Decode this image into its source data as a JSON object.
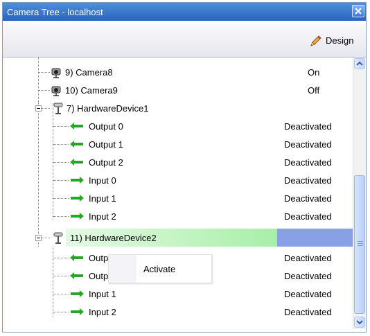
{
  "window": {
    "title": "Camera Tree - localhost"
  },
  "toolbar": {
    "design_label": "Design"
  },
  "tree": {
    "rows": [
      {
        "label": "9) Camera8",
        "status": "On"
      },
      {
        "label": "10) Camera9",
        "status": "Off"
      },
      {
        "label": "7) HardwareDevice1",
        "status": ""
      },
      {
        "label": "Output 0",
        "status": "Deactivated"
      },
      {
        "label": "Output 1",
        "status": "Deactivated"
      },
      {
        "label": "Output 2",
        "status": "Deactivated"
      },
      {
        "label": "Input 0",
        "status": "Deactivated"
      },
      {
        "label": "Input 1",
        "status": "Deactivated"
      },
      {
        "label": "Input 2",
        "status": "Deactivated"
      },
      {
        "label": "11) HardwareDevice2",
        "status": ""
      },
      {
        "label": "Output 1",
        "status": "Deactivated"
      },
      {
        "label": "Output 2",
        "status": "Deactivated"
      },
      {
        "label": "Input 1",
        "status": "Deactivated"
      },
      {
        "label": "Input 2",
        "status": "Deactivated"
      }
    ]
  },
  "context_menu": {
    "activate_label": "Activate"
  },
  "colors": {
    "selection_start": "#e4fae4",
    "selection_end": "#a8eea8",
    "selection_status": "#8aa0e6",
    "output_arrow": "#2aa52a",
    "input_arrow": "#22aa22"
  }
}
